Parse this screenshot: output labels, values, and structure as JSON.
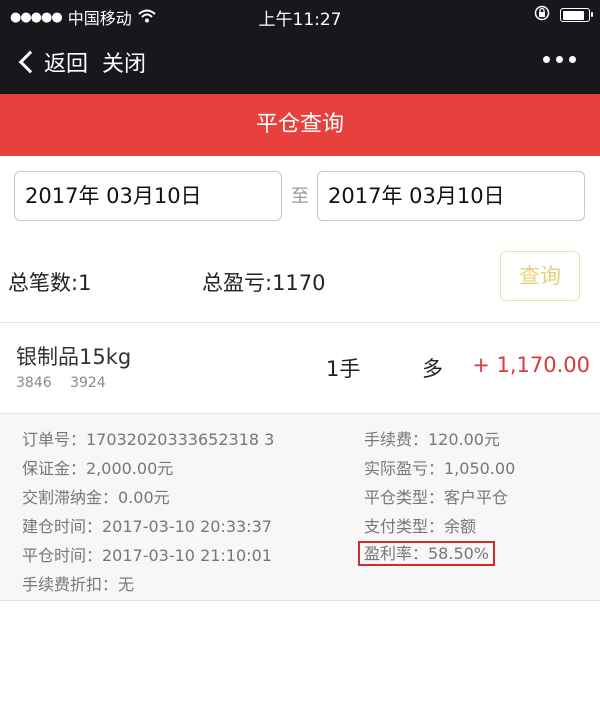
{
  "status_bar": {
    "signal_dots": "●●●●●",
    "carrier": "中国移动",
    "wifi_icon": "wifi-icon",
    "time": "上午11:27",
    "lock_icon": "orientation-lock-icon",
    "battery_level": 0.9
  },
  "nav": {
    "back_label": "返回",
    "close_label": "关闭",
    "more_icon": "more-icon"
  },
  "page_title": "平仓查询",
  "query": {
    "start_date": "2017年 03月10日",
    "to_label": "至",
    "end_date": "2017年 03月10日",
    "button_label": "查询"
  },
  "summary": {
    "total_count": "总笔数:1",
    "total_pl": "总盈亏:1170"
  },
  "record": {
    "name": "银制品15kg",
    "code": "3846  3924",
    "quantity": "1手",
    "direction": "多",
    "profit": "+ 1,170.00"
  },
  "details": {
    "left": [
      "订单号：17032020333652318 3",
      "保证金：2,000.00元",
      "交割滞纳金：0.00元",
      "建仓时间：2017-03-10 20:33:37",
      "平仓时间：2017-03-10 21:10:01",
      "手续费折扣：无"
    ],
    "right": [
      "手续费：120.00元",
      "实际盈亏：1,050.00",
      "平仓类型：客户平仓",
      "支付类型：余额",
      "盈利率：58.50%"
    ]
  },
  "colors": {
    "header_bg": "#17181b",
    "title_bg": "#e8413d",
    "profit_red": "#d93a3a",
    "highlight_border": "#c9302c"
  }
}
